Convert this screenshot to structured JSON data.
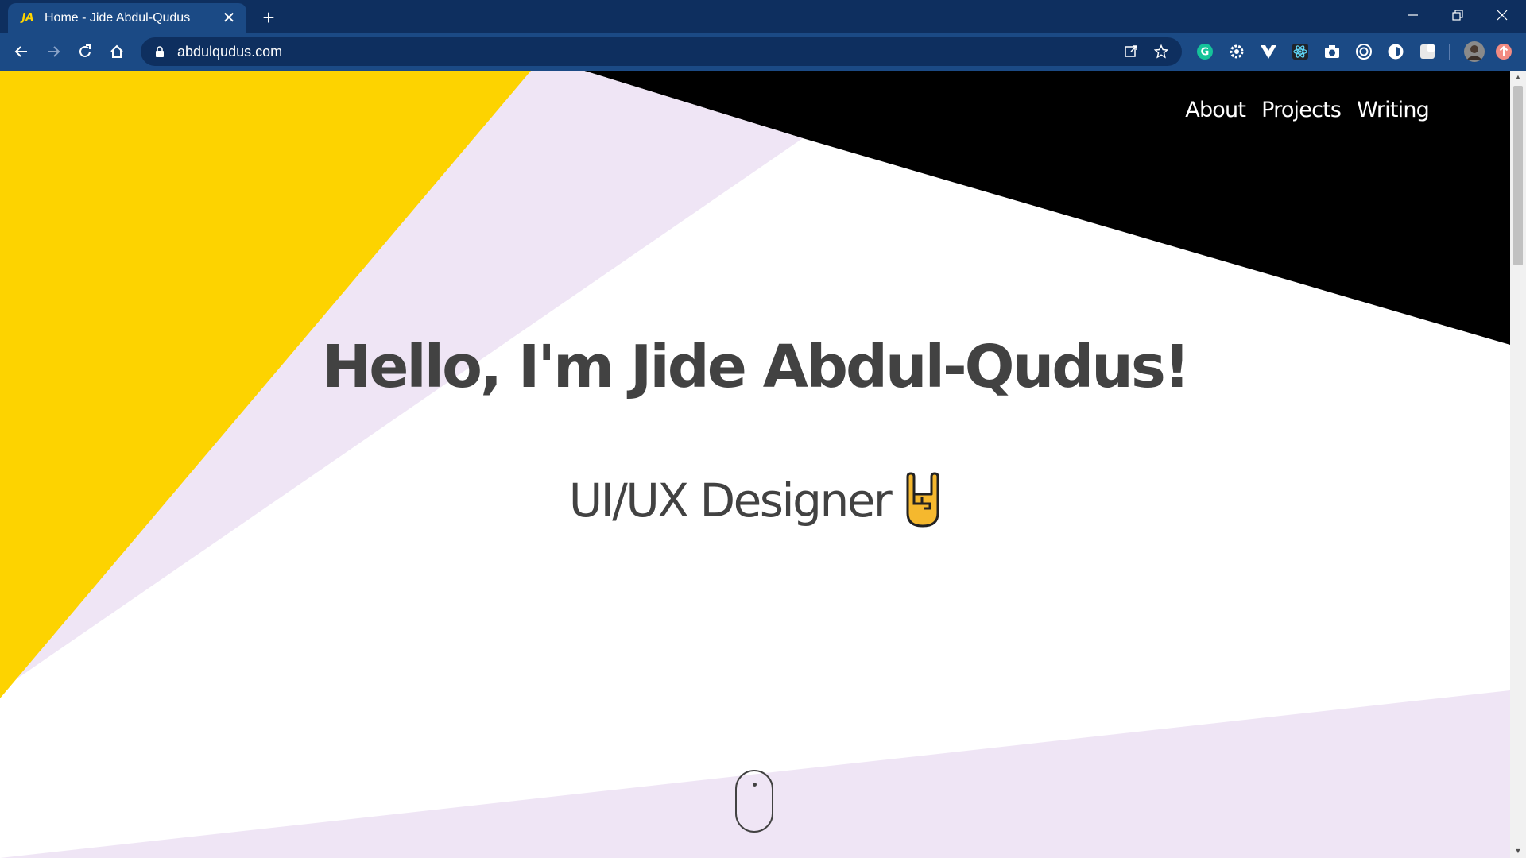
{
  "browser": {
    "tab": {
      "title": "Home - Jide Abdul-Qudus",
      "favicon": "JA"
    },
    "address": {
      "url": "abdulqudus.com"
    },
    "colors": {
      "tabstrip": "#0e2f5f",
      "toolbar": "#1b4a85",
      "omnibox": "#0e2f5f"
    },
    "extensions": [
      "grammarly-icon",
      "gear-extension-icon",
      "vue-devtools-icon",
      "react-devtools-icon",
      "camera-icon",
      "target-icon",
      "circle-extension-icon",
      "puzzle-extensions-icon",
      "profile-avatar",
      "update-icon"
    ]
  },
  "site": {
    "nav": {
      "about": "About",
      "projects": "Projects",
      "writing": "Writing"
    },
    "hero": {
      "title": "Hello, I'm Jide Abdul-Qudus!",
      "subtitle": "UI/UX Designer"
    },
    "colors": {
      "yellow": "#fdd300",
      "lavender": "#efe5f5",
      "black": "#000000",
      "text": "#424242"
    }
  }
}
